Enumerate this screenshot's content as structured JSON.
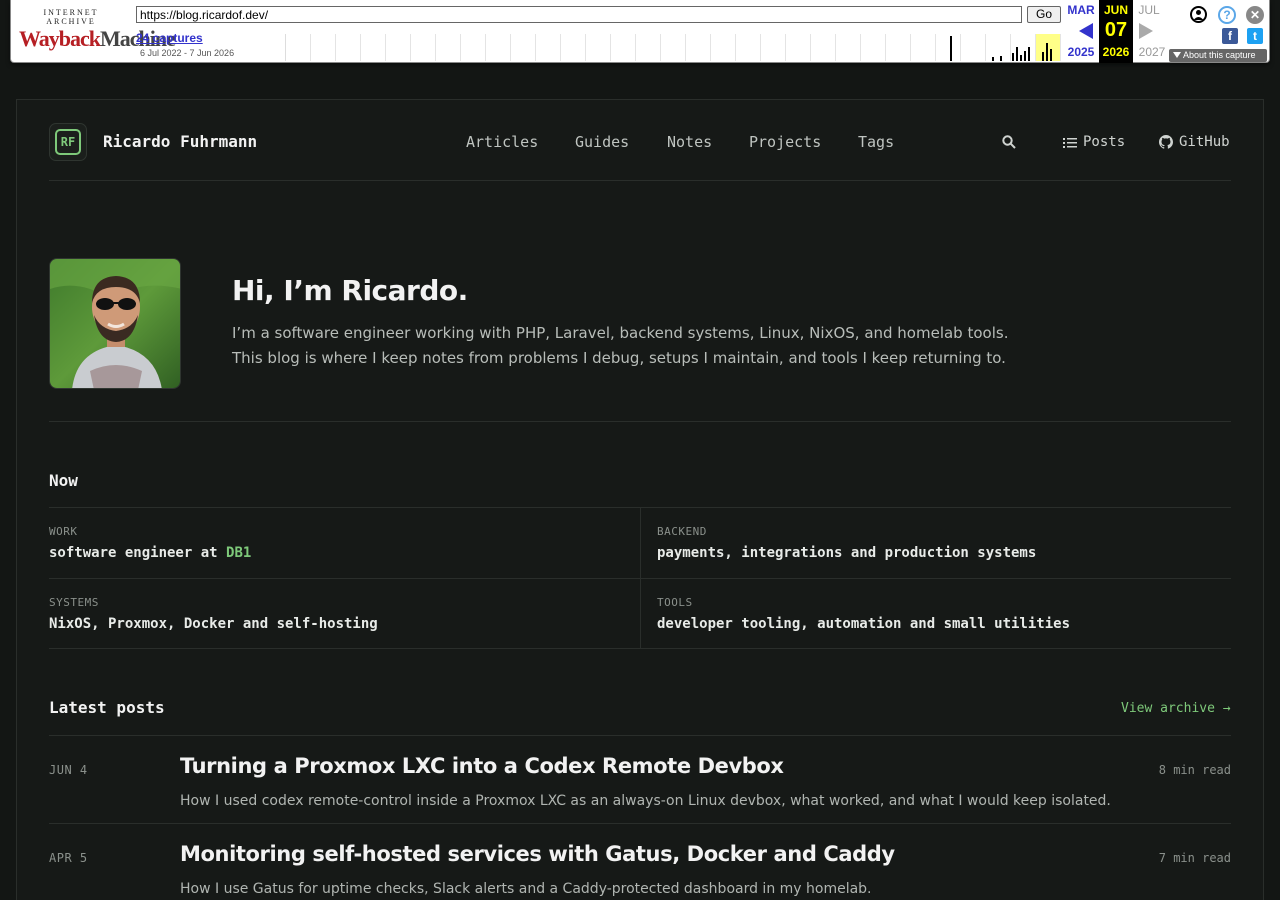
{
  "wayback": {
    "brand_top": "INTERNET ARCHIVE",
    "brand_wayback": "Wayback",
    "brand_machine": "Machine",
    "url": "https://blog.ricardof.dev/",
    "go_label": "Go",
    "captures": "24 captures",
    "range": "6 Jul 2022 - 7 Jun 2026",
    "prev_month": "MAR",
    "prev_year": "2025",
    "cur_month": "JUN",
    "cur_day": "07",
    "cur_year": "2026",
    "next_month": "JUL",
    "next_year": "2027",
    "about": "About this capture"
  },
  "site": {
    "logo_initials": "RF",
    "name": "Ricardo Fuhrmann",
    "nav": [
      "Articles",
      "Guides",
      "Notes",
      "Projects",
      "Tags"
    ],
    "posts_label": "Posts",
    "github_label": "GitHub",
    "accent": "#7ec97a"
  },
  "hero": {
    "title": "Hi, I’m Ricardo.",
    "description": "I’m a software engineer working with PHP, Laravel, backend systems, Linux, NixOS, and homelab tools. This blog is where I keep notes from problems I debug, setups I maintain, and tools I keep returning to."
  },
  "now": {
    "title": "Now",
    "work_key": "WORK",
    "work_value": "software engineer at ",
    "work_company": "DB1",
    "backend_key": "BACKEND",
    "backend_value": "payments, integrations and production systems",
    "systems_key": "SYSTEMS",
    "systems_value": "NixOS, Proxmox, Docker and self-hosting",
    "tools_key": "TOOLS",
    "tools_value": "developer tooling, automation and small utilities"
  },
  "latest": {
    "title": "Latest posts",
    "view_archive": "View archive →",
    "posts": [
      {
        "date": "JUN 4",
        "title": "Turning a Proxmox LXC into a Codex Remote Devbox",
        "description": "How I used codex remote-control inside a Proxmox LXC as an always-on Linux devbox, what worked, and what I would keep isolated.",
        "read": "8 min read"
      },
      {
        "date": "APR 5",
        "title": "Monitoring self-hosted services with Gatus, Docker and Caddy",
        "description": "How I use Gatus for uptime checks, Slack alerts and a Caddy-protected dashboard in my homelab.",
        "read": "7 min read"
      }
    ]
  }
}
